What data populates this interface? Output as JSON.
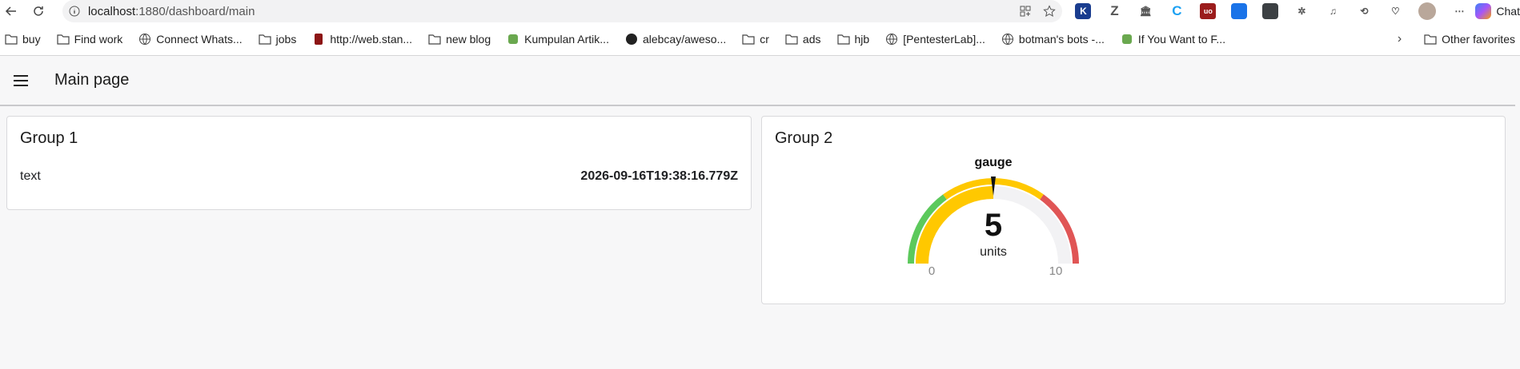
{
  "browser": {
    "url_host": "localhost",
    "url_rest": ":1880/dashboard/main",
    "copilot_label": "Chat"
  },
  "bookmarks": [
    {
      "label": "buy",
      "icon": "folder-icon"
    },
    {
      "label": "Find work",
      "icon": "folder-icon"
    },
    {
      "label": "Connect Whats...",
      "icon": "globe-icon"
    },
    {
      "label": "jobs",
      "icon": "folder-icon"
    },
    {
      "label": "http://web.stan...",
      "icon": "stanford-icon"
    },
    {
      "label": "new blog",
      "icon": "folder-icon"
    },
    {
      "label": "Kumpulan Artik...",
      "icon": "site-icon"
    },
    {
      "label": "alebcay/aweso...",
      "icon": "github-icon"
    },
    {
      "label": "cr",
      "icon": "folder-icon"
    },
    {
      "label": "ads",
      "icon": "folder-icon"
    },
    {
      "label": "hjb",
      "icon": "folder-icon"
    },
    {
      "label": "[PentesterLab]...",
      "icon": "globe-icon"
    },
    {
      "label": "botman's bots -...",
      "icon": "globe-icon"
    },
    {
      "label": "If You Want to F...",
      "icon": "site-icon"
    }
  ],
  "other_favorites": "Other favorites",
  "dashboard": {
    "page_title": "Main page",
    "group1": {
      "title": "Group 1",
      "text_label": "text",
      "text_value": "2026-09-16T19:38:16.779Z"
    },
    "group2": {
      "title": "Group 2",
      "gauge": {
        "label": "gauge",
        "value": 5,
        "value_text": "5",
        "units": "units",
        "min": 0,
        "max": 10,
        "min_text": "0",
        "max_text": "10",
        "segments": [
          {
            "from": 0,
            "to": 3,
            "color": "#5cc95c"
          },
          {
            "from": 3,
            "to": 7,
            "color": "#ffc800"
          },
          {
            "from": 7,
            "to": 10,
            "color": "#e05555"
          }
        ],
        "fill_color": "#ffc800",
        "track_color": "#f2f2f4"
      }
    }
  }
}
